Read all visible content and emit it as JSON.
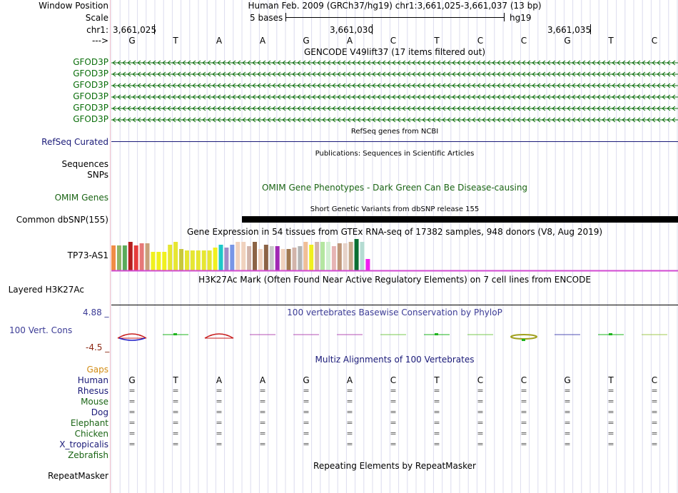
{
  "header": {
    "window_position_label": "Window Position",
    "window_position_text": "Human Feb. 2009 (GRCh37/hg19)   chr1:3,661,025-3,661,037 (13 bp)",
    "scale_label": "Scale",
    "scale_text": "5 bases",
    "assembly": "hg19",
    "chrom_label": "chr1:",
    "coords": [
      "3,661,025",
      "3,661,030",
      "3,661,035"
    ],
    "strand_label": "--->",
    "bases": [
      "G",
      "T",
      "A",
      "A",
      "G",
      "A",
      "C",
      "T",
      "C",
      "C",
      "G",
      "T",
      "C"
    ]
  },
  "gencode": {
    "title": "GENCODE V49lift37 (17 items filtered out)",
    "rows": [
      "GFOD3P",
      "GFOD3P",
      "GFOD3P",
      "GFOD3P",
      "GFOD3P",
      "GFOD3P"
    ],
    "color": "#0a6e0a"
  },
  "refseq": {
    "label": "RefSeq Curated",
    "title": "RefSeq genes from NCBI",
    "color": "#1a1a78"
  },
  "publications": {
    "title": "Publications: Sequences in Scientific Articles",
    "labels": [
      "Sequences",
      "SNPs"
    ]
  },
  "omim": {
    "label": "OMIM Genes",
    "title": "OMIM Gene Phenotypes - Dark Green Can Be Disease-causing"
  },
  "dbsnp": {
    "label": "Common dbSNP(155)",
    "title": "Short Genetic Variants from dbSNP release 155"
  },
  "gtex": {
    "title": "Gene Expression in 54 tissues from GTEx RNA-seq of 17382 samples, 948 donors (V8, Aug 2019)",
    "label": "TP73-AS1",
    "bar_color_gtex_line": "#d24ad2"
  },
  "h3k27ac": {
    "title": "H3K27Ac Mark (Often Found Near Active Regulatory Elements) on 7 cell lines from ENCODE",
    "label": "Layered H3K27Ac"
  },
  "phylop": {
    "title": "100 vertebrates Basewise Conservation by PhyloP",
    "label": "100 Vert. Cons",
    "max": "4.88 _",
    "min": "-4.5 _"
  },
  "multiz": {
    "title": "Multiz Alignments of 100 Vertebrates",
    "gaps_label": "Gaps",
    "species": [
      "Human",
      "Rhesus",
      "Mouse",
      "Dog",
      "Elephant",
      "Chicken",
      "X_tropicalis",
      "Zebrafish"
    ],
    "equals": "="
  },
  "repeatmasker": {
    "label": "RepeatMasker",
    "title": "Repeating Elements by RepeatMasker"
  }
}
